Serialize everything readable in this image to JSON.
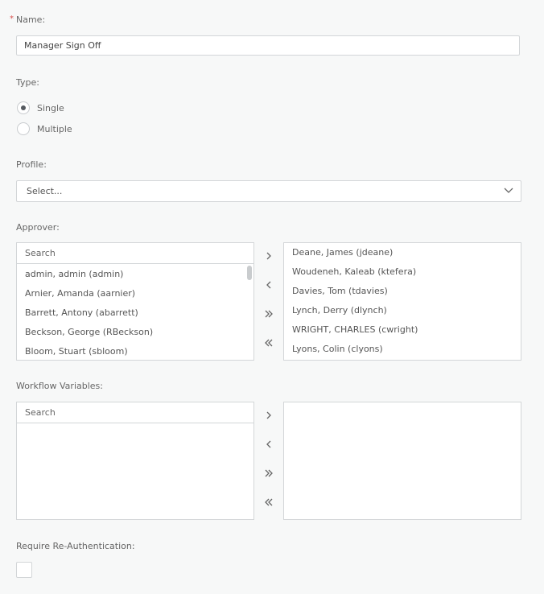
{
  "name_field": {
    "required_mark": "*",
    "label": "Name:",
    "value": "Manager Sign Off"
  },
  "type_field": {
    "label": "Type:",
    "options": [
      {
        "label": "Single",
        "checked": true
      },
      {
        "label": "Multiple",
        "checked": false
      }
    ]
  },
  "profile_field": {
    "label": "Profile:",
    "selected": "Select..."
  },
  "approver": {
    "label": "Approver:",
    "search_placeholder": "Search",
    "available": [
      "admin, admin (admin)",
      "Arnier, Amanda (aarnier)",
      "Barrett, Antony (abarrett)",
      "Beckson, George (RBeckson)",
      "Bloom, Stuart (sbloom)"
    ],
    "selected": [
      "Deane, James (jdeane)",
      "Woudeneh, Kaleab (ktefera)",
      "Davies, Tom (tdavies)",
      "Lynch, Derry (dlynch)",
      "WRIGHT, CHARLES (cwright)",
      "Lyons, Colin (clyons)"
    ]
  },
  "workflow_variables": {
    "label": "Workflow Variables:",
    "search_placeholder": "Search",
    "available": [],
    "selected": []
  },
  "reauth": {
    "label": "Require Re-Authentication:",
    "checked": false
  },
  "icons": {
    "move_right": "chevron-right-icon",
    "move_left": "chevron-left-icon",
    "move_all_right": "double-chevron-right-icon",
    "move_all_left": "double-chevron-left-icon",
    "dropdown": "chevron-down-icon"
  },
  "colors": {
    "background": "#f7f8f8",
    "border": "#d3d6d8",
    "required": "#d9534f",
    "radio_dot": "#555a60"
  }
}
